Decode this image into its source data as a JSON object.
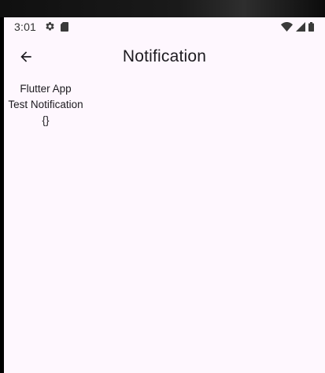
{
  "status_bar": {
    "time": "3:01",
    "left_icons": [
      "gear-icon",
      "sd-card-icon"
    ],
    "right_icons": [
      "wifi-icon",
      "cellular-signal-icon",
      "battery-icon"
    ]
  },
  "app_bar": {
    "back_icon": "arrow-left-icon",
    "title": "Notification"
  },
  "notification": {
    "app_name": "Flutter App",
    "message": "Test Notification",
    "payload": "{}"
  },
  "colors": {
    "background": "#fef7fe",
    "text": "#1d1b20",
    "status_icons": "#3a3a3a"
  }
}
